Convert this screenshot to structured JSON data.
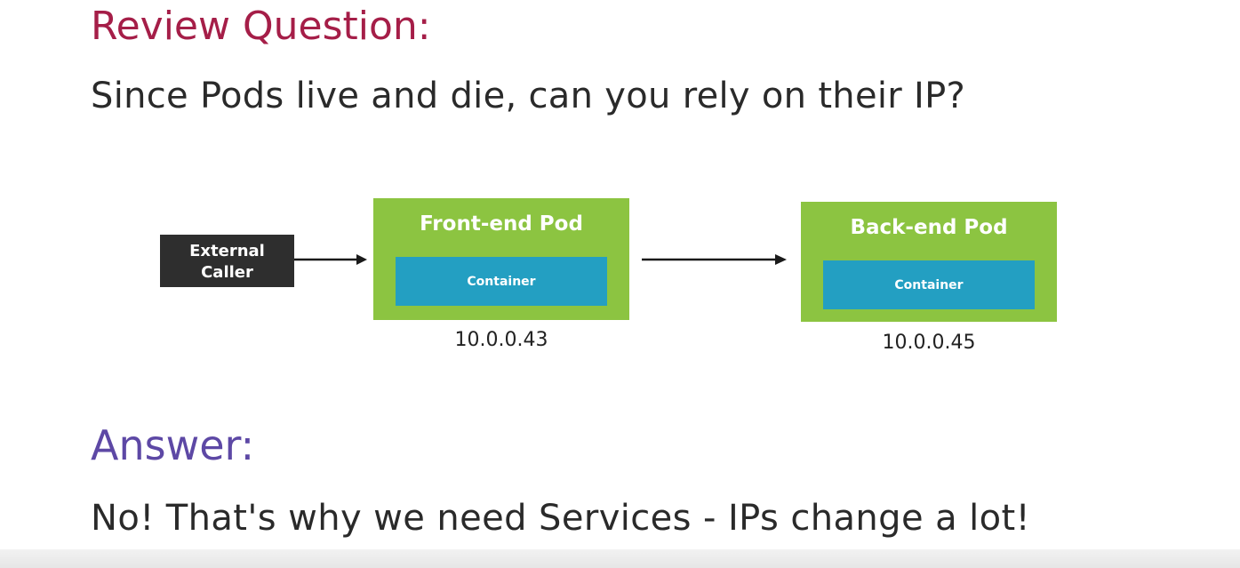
{
  "review": {
    "heading": "Review Question:",
    "question": "Since Pods live and die, can you rely on their IP?"
  },
  "diagram": {
    "caller": {
      "line1": "External",
      "line2": "Caller"
    },
    "front_pod": {
      "title": "Front-end Pod",
      "container_label": "Container",
      "ip": "10.0.0.43"
    },
    "back_pod": {
      "title": "Back-end Pod",
      "container_label": "Container",
      "ip": "10.0.0.45"
    }
  },
  "answer": {
    "heading": "Answer:",
    "text": "No! That's why we need Services - IPs change a lot!"
  },
  "colors": {
    "review_heading": "#a51e48",
    "answer_heading": "#5d48a5",
    "pod_green": "#8cc441",
    "container_blue": "#239fc2",
    "caller_dark": "#2e2e2e"
  }
}
